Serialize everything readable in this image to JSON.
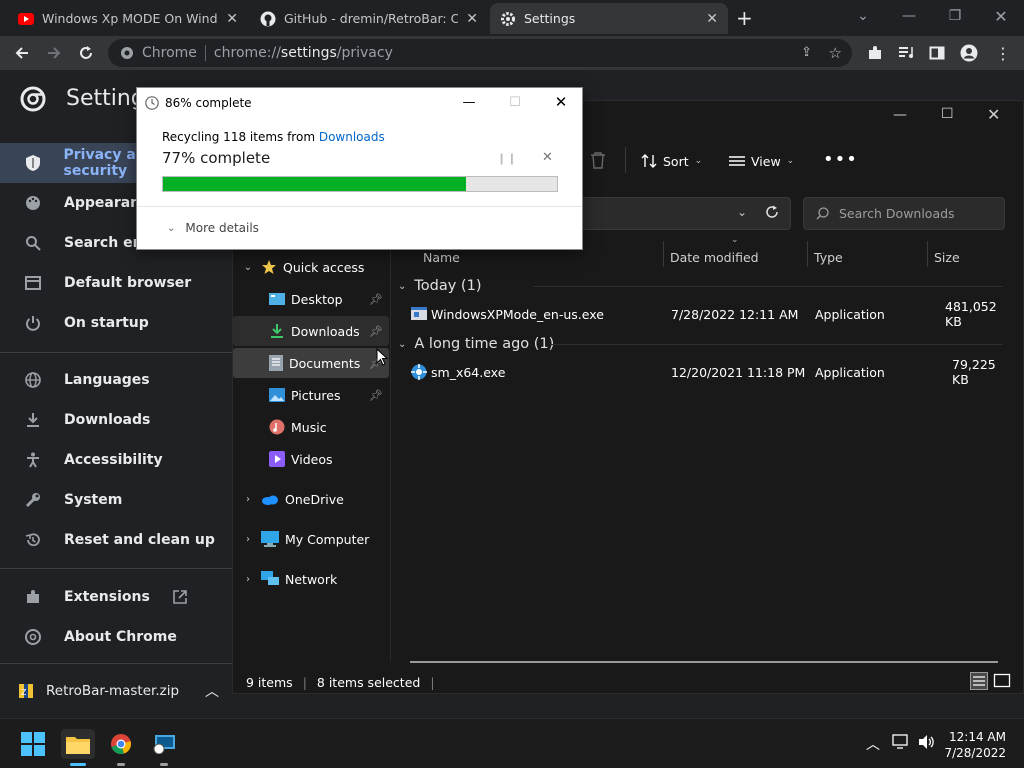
{
  "chrome": {
    "tabs": [
      {
        "title": "Windows Xp MODE On Windows",
        "icon": "youtube-icon",
        "active": false
      },
      {
        "title": "GitHub - dremin/RetroBar: Classic",
        "icon": "github-icon",
        "active": false
      },
      {
        "title": "Settings",
        "icon": "gear-icon",
        "active": true
      }
    ],
    "omnibox": {
      "scheme_label": "Chrome",
      "url_prefix": "chrome://",
      "url_host": "settings",
      "url_path": "/privacy"
    }
  },
  "settings": {
    "header_title": "Settings",
    "nav": [
      {
        "label": "Privacy and security",
        "icon": "shield-icon"
      },
      {
        "label": "Appearance",
        "icon": "palette-icon"
      },
      {
        "label": "Search engine",
        "icon": "search-icon"
      },
      {
        "label": "Default browser",
        "icon": "browser-icon"
      },
      {
        "label": "On startup",
        "icon": "power-icon"
      },
      {
        "label": "Languages",
        "icon": "globe-icon"
      },
      {
        "label": "Downloads",
        "icon": "download-icon"
      },
      {
        "label": "Accessibility",
        "icon": "accessibility-icon"
      },
      {
        "label": "System",
        "icon": "wrench-icon"
      },
      {
        "label": "Reset and clean up",
        "icon": "restore-icon"
      },
      {
        "label": "Extensions",
        "icon": "puzzle-icon"
      },
      {
        "label": "About Chrome",
        "icon": "chrome-icon"
      }
    ]
  },
  "download_shelf": {
    "filename": "RetroBar-master.zip"
  },
  "explorer": {
    "commands": {
      "sort": "Sort",
      "view": "View"
    },
    "search_placeholder": "Search Downloads",
    "nav": {
      "quick_access": "Quick access",
      "items": [
        {
          "label": "Desktop",
          "icon": "desktop-folder-icon",
          "pinned": true
        },
        {
          "label": "Downloads",
          "icon": "downloads-folder-icon",
          "pinned": true
        },
        {
          "label": "Documents",
          "icon": "documents-folder-icon",
          "pinned": true
        },
        {
          "label": "Pictures",
          "icon": "pictures-folder-icon",
          "pinned": true
        },
        {
          "label": "Music",
          "icon": "music-folder-icon",
          "pinned": false
        },
        {
          "label": "Videos",
          "icon": "videos-folder-icon",
          "pinned": false
        }
      ],
      "roots": [
        {
          "label": "OneDrive",
          "icon": "onedrive-icon"
        },
        {
          "label": "My Computer",
          "icon": "computer-icon"
        },
        {
          "label": "Network",
          "icon": "network-icon"
        }
      ]
    },
    "columns": {
      "name": "Name",
      "date": "Date modified",
      "type": "Type",
      "size": "Size"
    },
    "groups": [
      {
        "label": "Today (1)",
        "files": [
          {
            "name": "WindowsXPMode_en-us.exe",
            "date": "7/28/2022 12:11 AM",
            "type": "Application",
            "size": "481,052 KB"
          }
        ]
      },
      {
        "label": "A long time ago (1)",
        "files": [
          {
            "name": "sm_x64.exe",
            "date": "12/20/2021 11:18 PM",
            "type": "Application",
            "size": "79,225 KB"
          }
        ]
      }
    ],
    "status": {
      "items": "9 items",
      "selected": "8 items selected"
    }
  },
  "dialog": {
    "title": "86% complete",
    "line1_prefix": "Recycling 118 items from ",
    "line1_link": "Downloads",
    "line2": "77% complete",
    "progress": 0.77,
    "more_details": "More details"
  },
  "taskbar": {
    "time": "12:14 AM",
    "date": "7/28/2022"
  },
  "colors": {
    "accent": "#8ab4f8",
    "progress": "#06b025",
    "link": "#0066cc"
  }
}
